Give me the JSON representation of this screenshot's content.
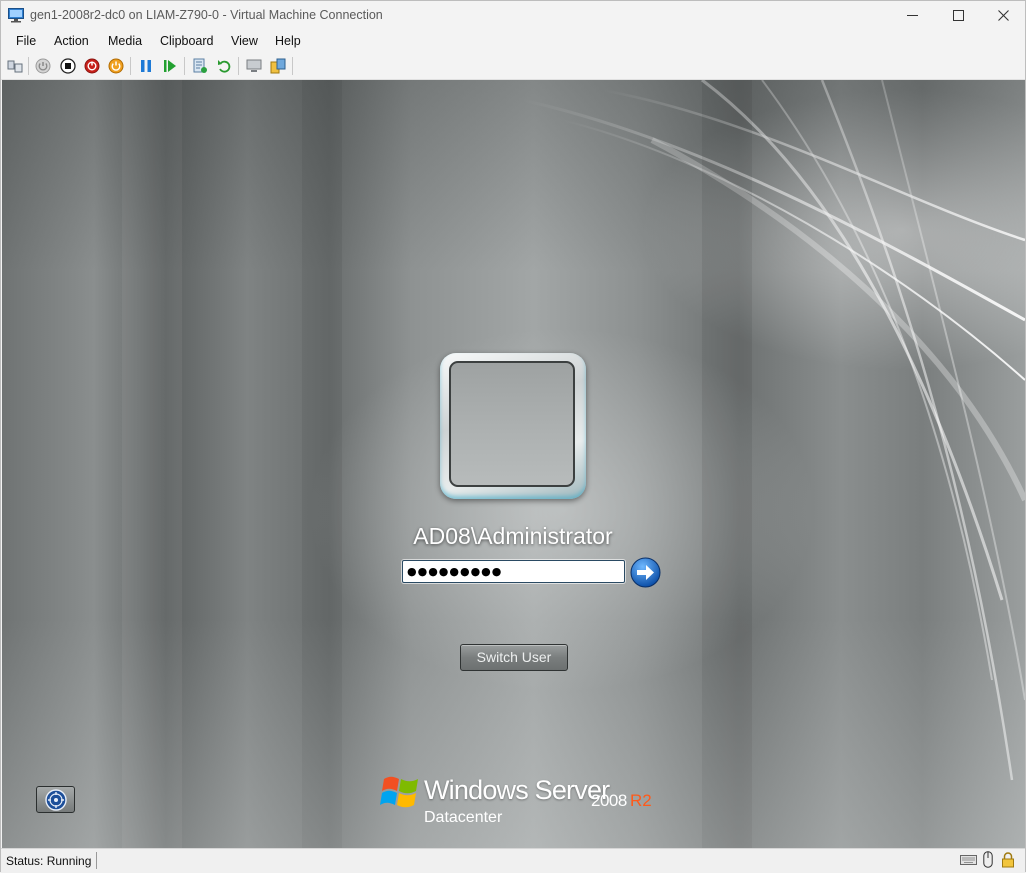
{
  "window": {
    "title": "gen1-2008r2-dc0 on LIAM-Z790-0 - Virtual Machine Connection",
    "icon": "vm-monitor-icon",
    "controls": [
      "minimize-icon",
      "maximize-icon",
      "close-icon"
    ]
  },
  "menu": {
    "items": [
      "File",
      "Action",
      "Media",
      "Clipboard",
      "View",
      "Help"
    ]
  },
  "toolbar": {
    "buttons": [
      "ctrl-alt-del-icon",
      "start-icon",
      "turn-off-icon",
      "shut-down-icon",
      "power-save-icon",
      "pause-icon",
      "resume-icon",
      "checkpoint-icon",
      "revert-icon",
      "enhanced-session-icon",
      "share-icon"
    ]
  },
  "login": {
    "username": "AD08\\Administrator",
    "password_masked": "●●●●●●●●●",
    "switch_user_label": "Switch User"
  },
  "branding": {
    "product": "Windows Server",
    "version": "2008",
    "release": "R2",
    "edition": "Datacenter",
    "release_color": "#ff5a1a"
  },
  "status": {
    "text": "Status: Running",
    "icons": [
      "keyboard-icon",
      "mouse-icon",
      "lock-icon"
    ]
  }
}
